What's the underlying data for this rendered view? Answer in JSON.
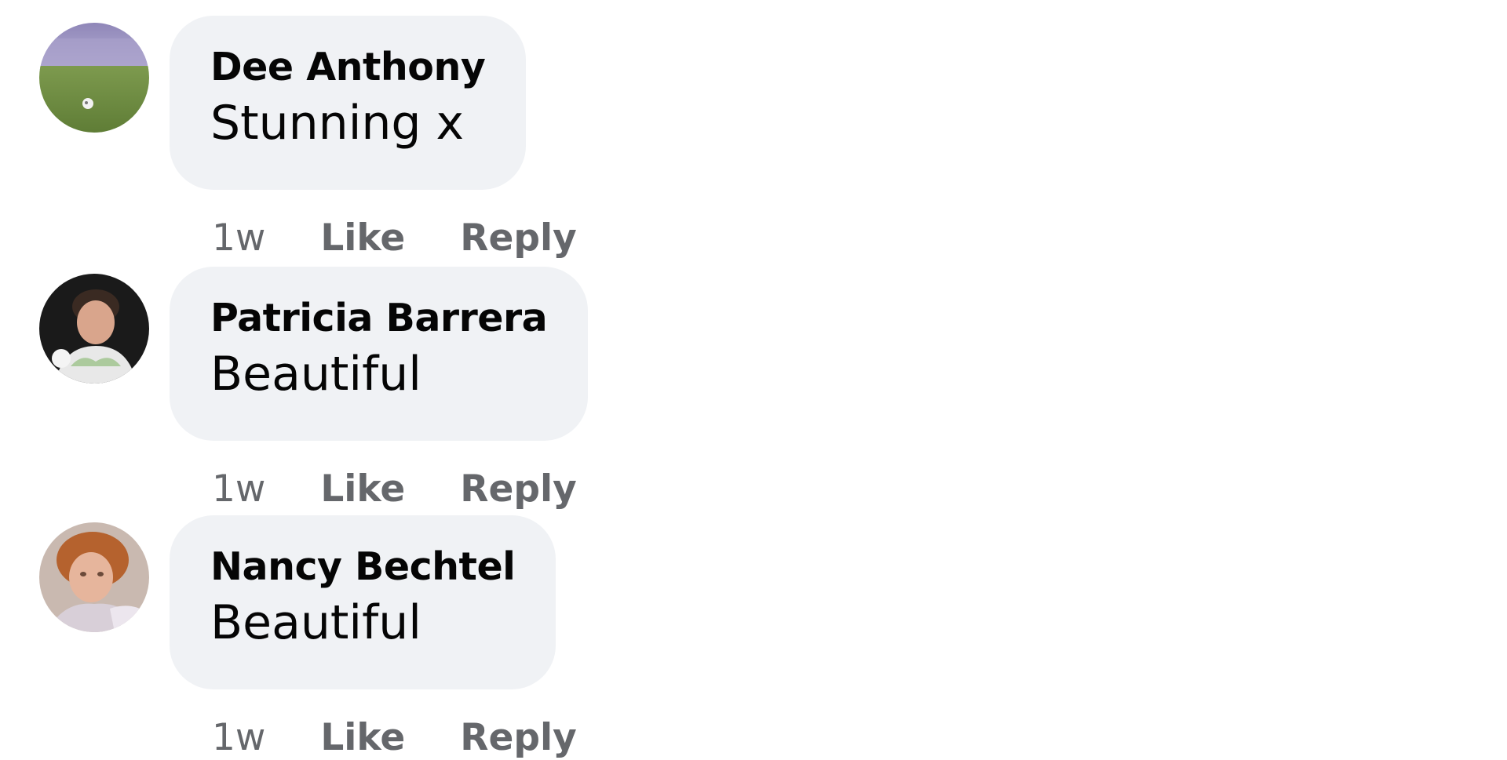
{
  "comments": [
    {
      "author": "Dee Anthony",
      "text": "Stunning x",
      "time": "1w",
      "like_label": "Like",
      "reply_label": "Reply",
      "avatar_icon": "avatar-photo-field"
    },
    {
      "author": "Patricia Barrera",
      "text": "Beautiful",
      "time": "1w",
      "like_label": "Like",
      "reply_label": "Reply",
      "avatar_icon": "avatar-photo-person"
    },
    {
      "author": "Nancy Bechtel",
      "text": "Beautiful",
      "time": "1w",
      "like_label": "Like",
      "reply_label": "Reply",
      "avatar_icon": "avatar-photo-person"
    }
  ],
  "colors": {
    "bubble_background": "#f0f2f5",
    "author_text": "#050505",
    "meta_text": "#65676b",
    "page_background": "#ffffff"
  }
}
